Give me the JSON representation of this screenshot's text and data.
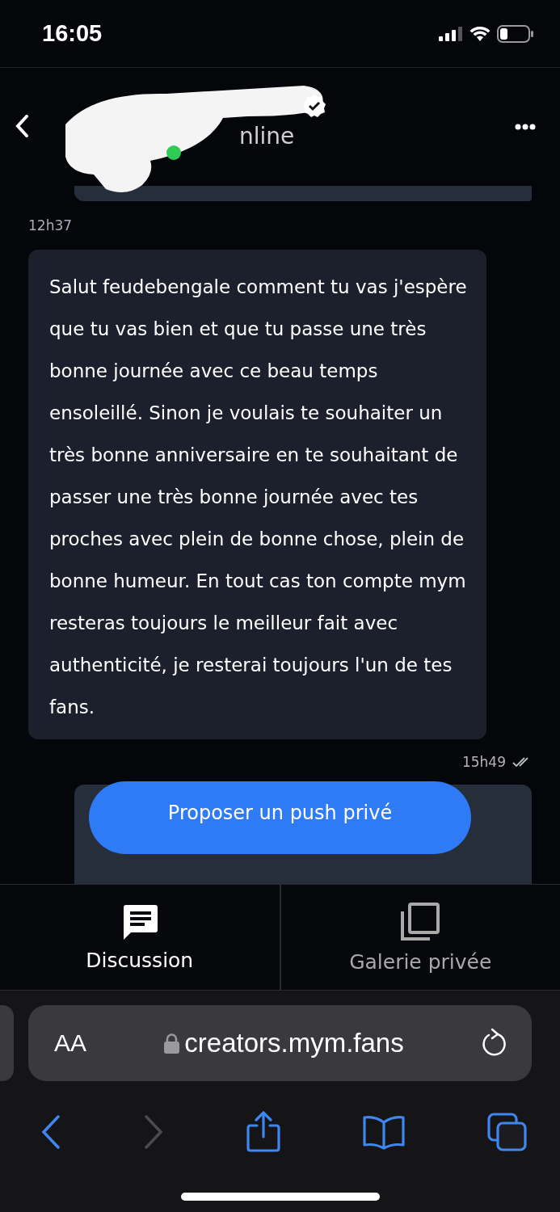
{
  "status_bar": {
    "time": "16:05"
  },
  "header": {
    "status": "nline",
    "verified": true,
    "online": true
  },
  "messages": [
    {
      "kind": "timestamp",
      "text": "12h37"
    },
    {
      "kind": "bubble",
      "text": "Salut feudebengale comment tu vas j'espère que tu vas bien et que tu passe une très bonne journée avec ce beau temps ensoleillé. Sinon je voulais te souhaiter un très bonne anniversaire en te souhaitant de passer une très bonne journée avec tes proches avec plein de bonne chose, plein de bonne humeur. En tout cas ton compte mym resteras toujours le meilleur fait avec authenticité, je resterai toujours l'un de tes fans."
    },
    {
      "kind": "sent_time",
      "text": "15h49",
      "read": true
    }
  ],
  "action_button": "Proposer un push privé",
  "tabs": [
    {
      "label": "Discussion",
      "selected": true
    },
    {
      "label": "Galerie privée",
      "selected": false
    }
  ],
  "browser": {
    "text_size": "AA",
    "url": "creators.mym.fans"
  }
}
